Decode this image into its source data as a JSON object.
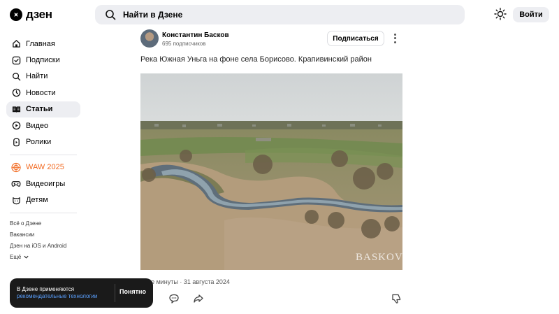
{
  "header": {
    "logo_text": "дзен",
    "search_placeholder": "Найти в Дзене",
    "login_label": "Войти"
  },
  "sidebar": {
    "items": [
      {
        "label": "Главная",
        "icon": "home-icon"
      },
      {
        "label": "Подписки",
        "icon": "subscriptions-icon"
      },
      {
        "label": "Найти",
        "icon": "search-icon"
      },
      {
        "label": "Новости",
        "icon": "news-icon"
      },
      {
        "label": "Статьи",
        "icon": "articles-icon",
        "active": true
      },
      {
        "label": "Видео",
        "icon": "video-icon"
      },
      {
        "label": "Ролики",
        "icon": "shorts-icon"
      }
    ],
    "items2": [
      {
        "label": "WAW 2025",
        "icon": "waw-icon"
      },
      {
        "label": "Видеоигры",
        "icon": "gamepad-icon"
      },
      {
        "label": "Детям",
        "icon": "kids-icon"
      }
    ],
    "footer": {
      "about": "Всё о Дзене",
      "jobs": "Вакансии",
      "apps": "Дзен на iOS и Android",
      "more": "Ещё"
    }
  },
  "article": {
    "author_name": "Константин Басков",
    "author_subs": "695 подписчиков",
    "subscribe_label": "Подписаться",
    "caption": "Река Южная Уньга на фоне села Борисово. Крапивинский район",
    "watermark": "BASKOV",
    "meta": "олее минуты · 31 августа 2024"
  },
  "toast": {
    "line1": "В Дзене применяются",
    "link": "рекомендательные технологии",
    "button": "Понятно"
  },
  "colors": {
    "accent_orange": "#f26a21",
    "link_blue": "#5aa0ff",
    "search_bg": "#edeef2"
  }
}
